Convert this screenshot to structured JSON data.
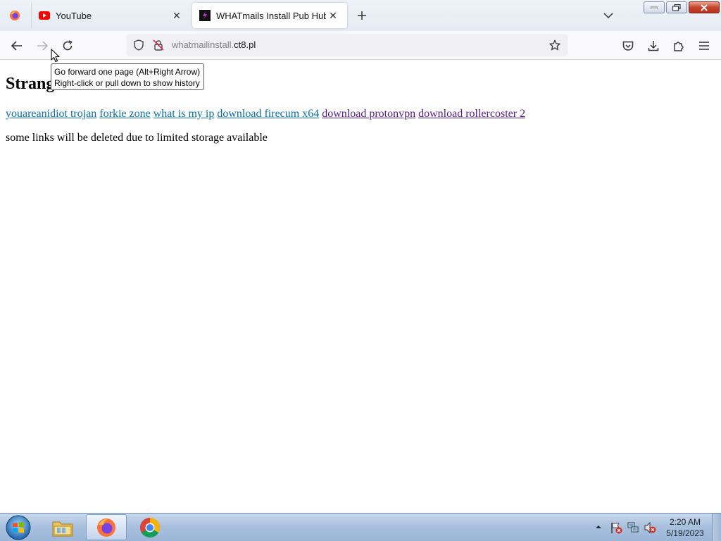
{
  "tabs": [
    {
      "title": "YouTube",
      "favicon": "youtube-icon",
      "active": false
    },
    {
      "title": "WHATmails Install Pub Hub",
      "favicon": "site-logo-icon",
      "active": true
    }
  ],
  "urlbar": {
    "url_muted": "whatmailinstall.",
    "url_host": "ct8.pl"
  },
  "tooltip": {
    "line1": "Go forward one page (Alt+Right Arrow)",
    "line2": "Right-click or pull down to show history"
  },
  "page": {
    "heading": "Strang",
    "links": [
      {
        "text": "youareanidiot trojan",
        "visited": false
      },
      {
        "text": "forkie zone",
        "visited": false
      },
      {
        "text": "what is my ip",
        "visited": false
      },
      {
        "text": "download firecum x64",
        "visited": false
      },
      {
        "text": "download protonvpn",
        "visited": true
      },
      {
        "text": "download rollercoster 2",
        "visited": true
      }
    ],
    "notice": "some links will be deleted due to limited storage available"
  },
  "taskbar": {
    "apps": [
      "file-explorer-icon",
      "firefox-icon",
      "chrome-icon"
    ],
    "clock_time": "2:20 AM",
    "clock_date": "5/19/2023"
  },
  "colors": {
    "link_unvisited": "#0b6fad",
    "link_visited": "#551a8b",
    "youtube_red": "#ff0000"
  }
}
